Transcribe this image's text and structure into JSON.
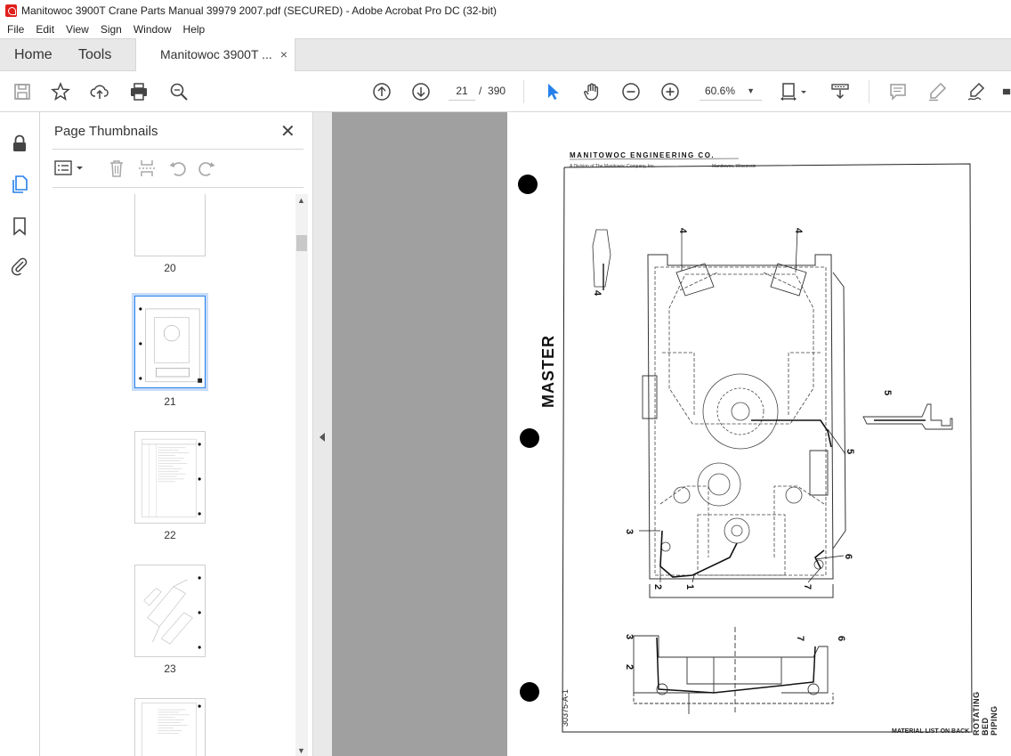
{
  "window": {
    "title": "Manitowoc 3900T Crane Parts Manual 39979 2007.pdf (SECURED) - Adobe Acrobat Pro DC (32-bit)"
  },
  "menu": [
    "File",
    "Edit",
    "View",
    "Sign",
    "Window",
    "Help"
  ],
  "tabs": {
    "home": "Home",
    "tools": "Tools",
    "document": "Manitowoc 3900T ...",
    "close": "×"
  },
  "toolbar": {
    "current_page": "21",
    "separator": "/",
    "total_pages": "390",
    "zoom": "60.6%"
  },
  "panel": {
    "title": "Page Thumbnails",
    "close": "✕",
    "thumbnails": [
      {
        "label": "20",
        "selected": false
      },
      {
        "label": "21",
        "selected": true
      },
      {
        "label": "22",
        "selected": false
      },
      {
        "label": "23",
        "selected": false
      },
      {
        "label": "",
        "selected": false
      }
    ]
  },
  "document": {
    "company": "MANITOWOC ENGINEERING CO.",
    "subtitle": "A Division of The Manitowoc Company, Inc.",
    "location": "Manitowoc, Wisconsin",
    "stamp": "MASTER",
    "part_number": "30375-A-1",
    "side_title": "ROTATING BED PIPING",
    "footer": "MATERIAL LIST ON BACK",
    "callouts": [
      "4",
      "4",
      "4",
      "5",
      "5",
      "3",
      "2",
      "1",
      "6",
      "7",
      "3",
      "2",
      "7",
      "6"
    ]
  },
  "colors": {
    "accent": "#2680eb",
    "selected_outline": "#c7dcf7",
    "canvas_bg": "#a0a0a0",
    "pdf_icon": "#e0201c"
  }
}
